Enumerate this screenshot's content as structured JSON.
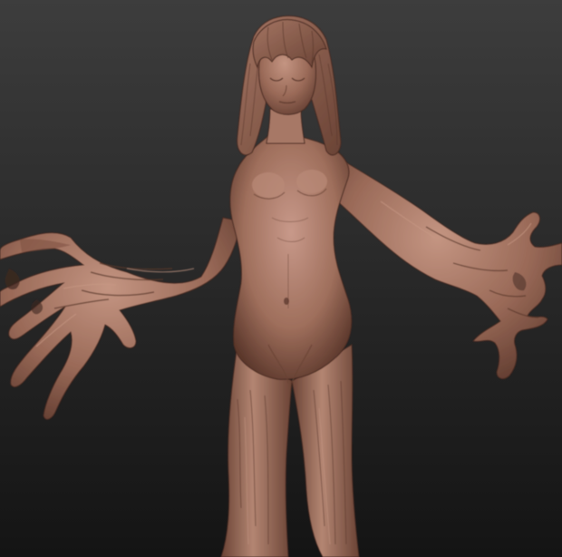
{
  "scene": {
    "subject": "clay-sculpt-tree-figure",
    "colors": {
      "background_top": "#3d3d3d",
      "background_bottom": "#141414",
      "clay_base": "#9a6a58",
      "clay_light": "#c49582",
      "clay_shadow": "#5e3a2e",
      "clay_dark": "#3e2620"
    }
  }
}
